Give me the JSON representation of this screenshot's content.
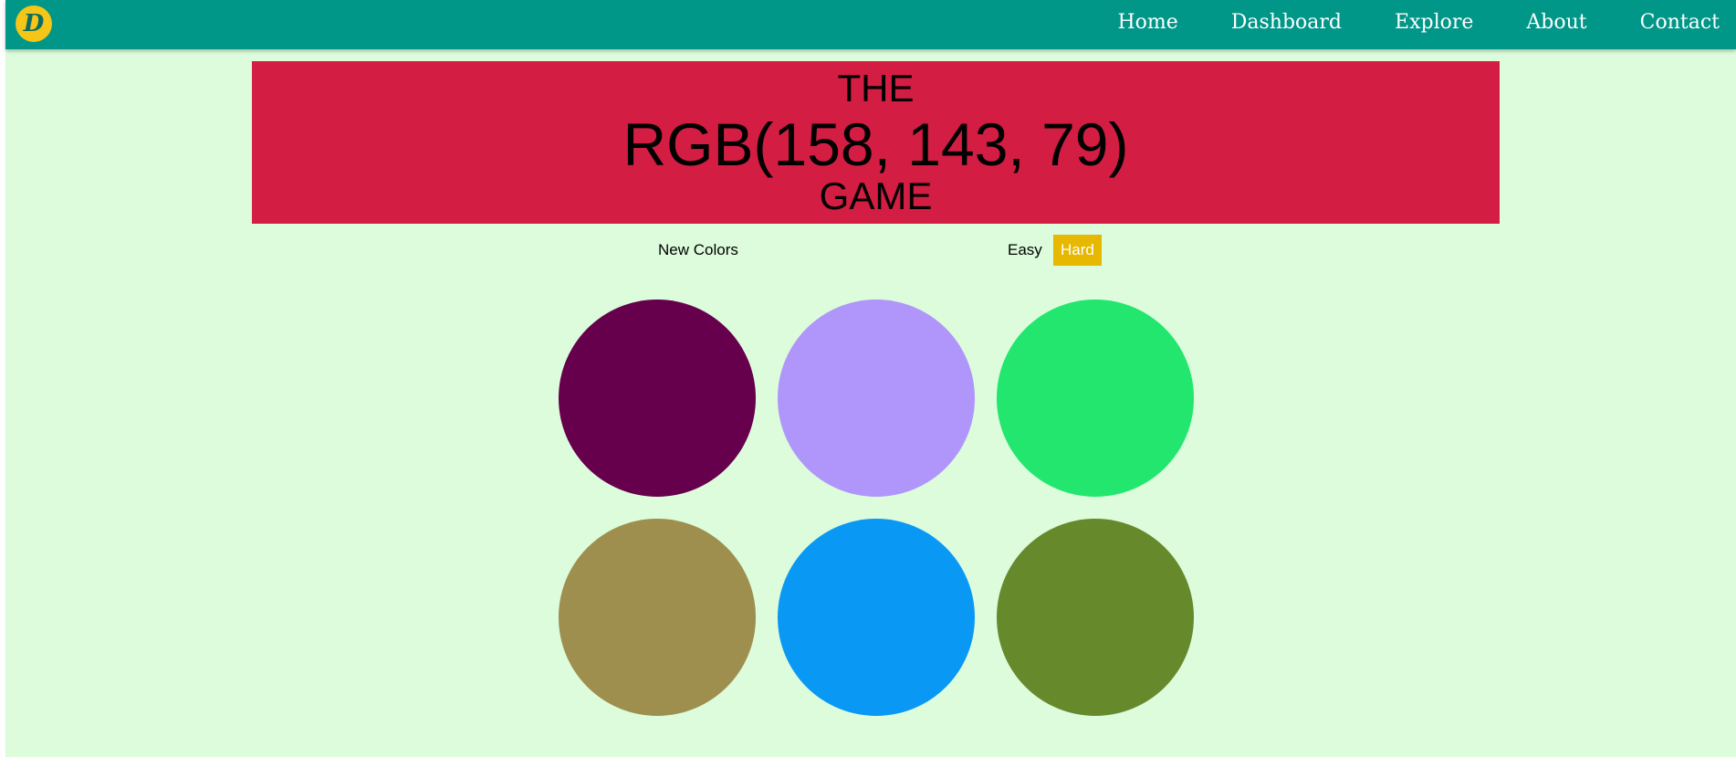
{
  "nav": {
    "logo_letter": "D",
    "links": [
      "Home",
      "Dashboard",
      "Explore",
      "About",
      "Contact"
    ]
  },
  "banner": {
    "top_text": "THE",
    "rgb_text": "RGB(158, 143, 79)",
    "bottom_text": "GAME",
    "color": "#d41d42"
  },
  "controls": {
    "new_colors_label": "New Colors",
    "easy_label": "Easy",
    "hard_label": "Hard",
    "selected_mode": "Hard",
    "selected_color": "#e6b800"
  },
  "swatches": [
    {
      "color": "#66004d"
    },
    {
      "color": "#b096fa"
    },
    {
      "color": "#23e66f"
    },
    {
      "color": "#9e8f4f"
    },
    {
      "color": "#0a98f5"
    },
    {
      "color": "#668a2b"
    }
  ],
  "page_background": "#dcfcdc",
  "navbar_color": "#009688"
}
